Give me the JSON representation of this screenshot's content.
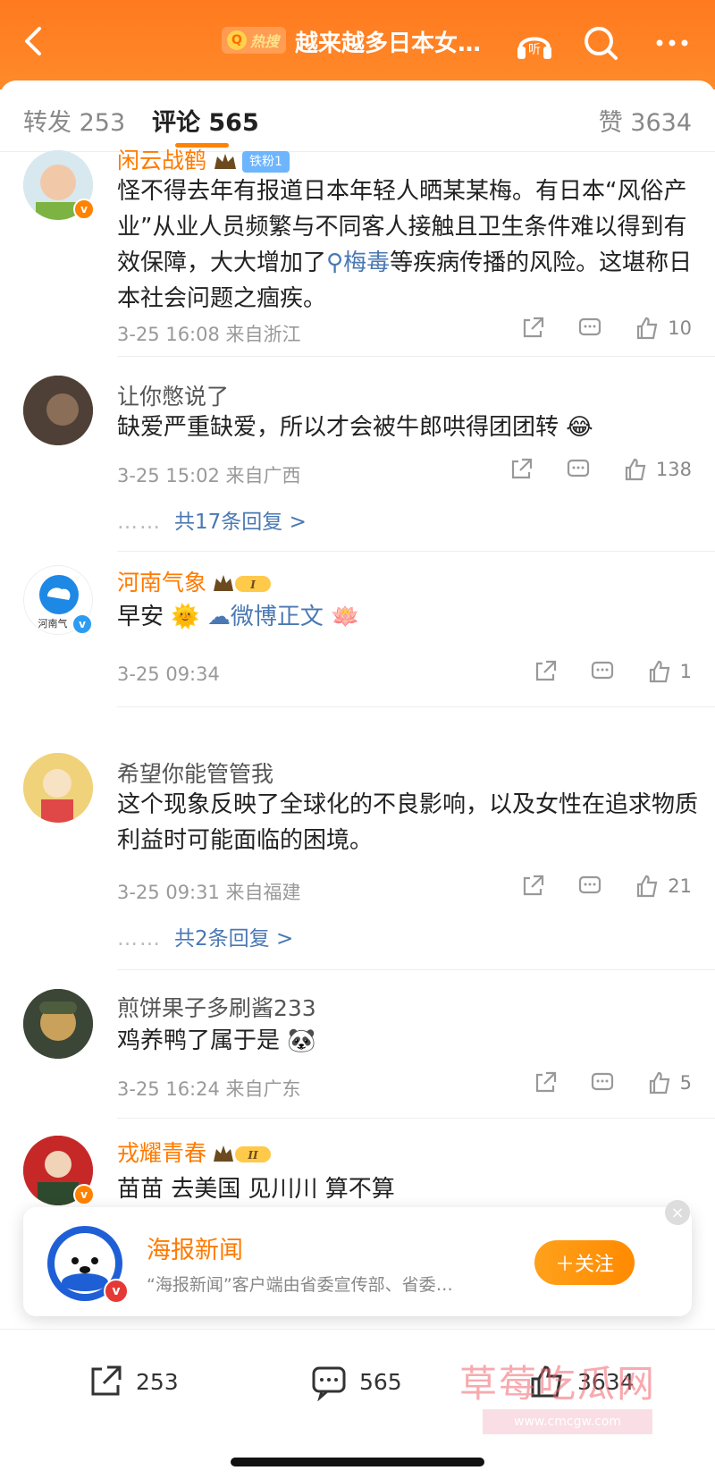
{
  "header": {
    "hot_label": "热搜",
    "title": "越来越多日本女…"
  },
  "tabs": {
    "repost": "转发 253",
    "comment": "评论 565",
    "like": "赞 3634"
  },
  "comments": [
    {
      "user": "闲云战鹤",
      "fan_badge": "铁粉1",
      "text_a": "怪不得去年有报道日本年轻人晒某某梅。有日本“风俗产业”从业人员频繁与不同客人接触且卫生条件难以得到有效保障，大大增加了",
      "keyword": "梅毒",
      "text_b": "等疾病传播的风险。这堪称日本社会问题之痼疾。",
      "time": "3-25 16:08 来自浙江",
      "likes": "10"
    },
    {
      "user": "让你憋说了",
      "text": "缺爱严重缺爱，所以才会被牛郎哄得团团转",
      "time": "3-25 15:02 来自广西",
      "likes": "138",
      "replies": "共17条回复 >"
    },
    {
      "user": "河南气象",
      "avatar_text": "河南气",
      "text": "早安",
      "link": "微博正文",
      "time": "3-25 09:34",
      "likes": "1"
    },
    {
      "user": "希望你能管管我",
      "text": "这个现象反映了全球化的不良影响，以及女性在追求物质利益时可能面临的困境。",
      "time": "3-25 09:31 来自福建",
      "likes": "21",
      "replies": "共2条回复 >"
    },
    {
      "user": "煎饼果子多刷酱233",
      "text": "鸡养鸭了属于是",
      "time": "3-25 16:24 来自广东",
      "likes": "5"
    },
    {
      "user": "戎耀青春",
      "text": "苗苗 去美国 见川川 算不算"
    }
  ],
  "popup": {
    "name": "海报新闻",
    "desc": "“海报新闻”客户端由省委宣传部、省委…",
    "follow": "＋关注"
  },
  "bottom": {
    "repost": "253",
    "comment": "565",
    "like": "3634"
  },
  "watermark": {
    "main": "草莓吃瓜网",
    "url": "www.cmcgw.com"
  },
  "colors": {
    "brand_orange": "#ff8200",
    "link_blue": "#4a78b3"
  }
}
